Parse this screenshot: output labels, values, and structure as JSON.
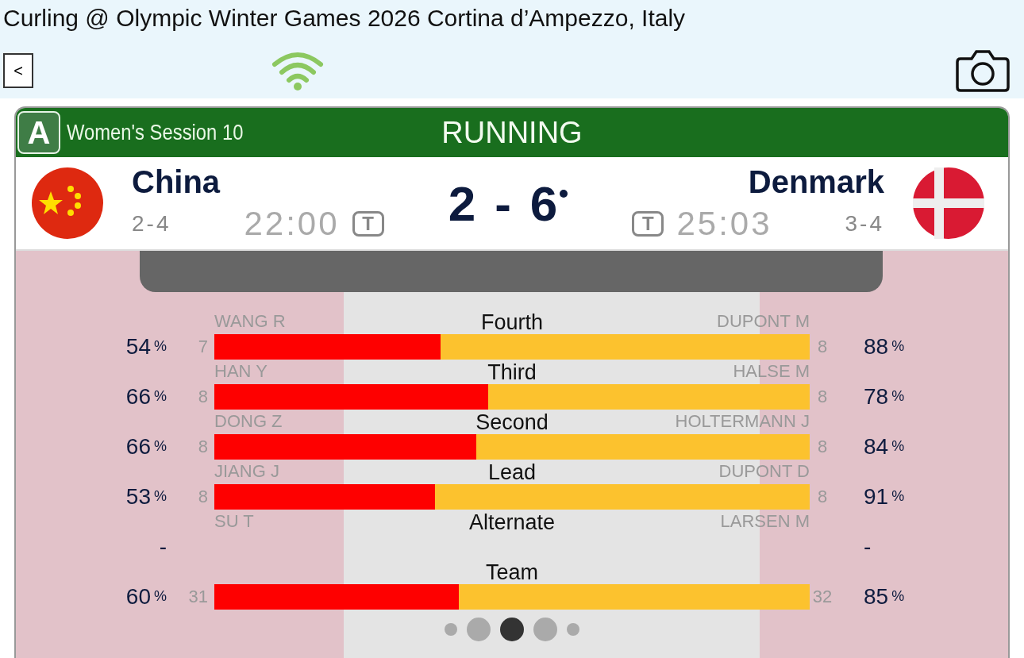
{
  "title": "Curling @ Olympic Winter Games 2026 Cortina d’Ampezzo, Italy",
  "toolbar": {
    "back": "<"
  },
  "header": {
    "sheet": "A",
    "session": "Women's Session 10",
    "status": "RUNNING"
  },
  "teams": [
    {
      "name": "China",
      "record": "2-4",
      "time": "22:00",
      "timeout_label": "T"
    },
    {
      "name": "Denmark",
      "record": "3-4",
      "time": "25:03",
      "timeout_label": "T"
    }
  ],
  "score": {
    "home": "2",
    "separator": "-",
    "away": "6",
    "home_hammer": false,
    "away_hammer": true
  },
  "stats": [
    {
      "position": "Fourth",
      "left_name": "WANG R",
      "right_name": "DUPONT M",
      "left_pct": "54",
      "left_count": "7",
      "right_count": "8",
      "right_pct": "88",
      "level": 0.38
    },
    {
      "position": "Third",
      "left_name": "HAN Y",
      "right_name": "HALSE M",
      "left_pct": "66",
      "left_count": "8",
      "right_count": "8",
      "right_pct": "78",
      "level": 0.46
    },
    {
      "position": "Second",
      "left_name": "DONG Z",
      "right_name": "HOLTERMANN J",
      "left_pct": "66",
      "left_count": "8",
      "right_count": "8",
      "right_pct": "84",
      "level": 0.44
    },
    {
      "position": "Lead",
      "left_name": "JIANG J",
      "right_name": "DUPONT D",
      "left_pct": "53",
      "left_count": "8",
      "right_count": "8",
      "right_pct": "91",
      "level": 0.37
    },
    {
      "position": "Alternate",
      "left_name": "SU T",
      "right_name": "LARSEN M",
      "left_pct": "-",
      "right_pct": "-"
    },
    {
      "position": "Team",
      "left_pct": "60",
      "left_count": "31",
      "right_count": "32",
      "right_pct": "85",
      "level": 0.41
    }
  ],
  "pct_unit": "%",
  "pages": [
    {
      "selected": false
    },
    {
      "selected": false
    },
    {
      "selected": true
    },
    {
      "selected": false
    },
    {
      "selected": false
    }
  ]
}
